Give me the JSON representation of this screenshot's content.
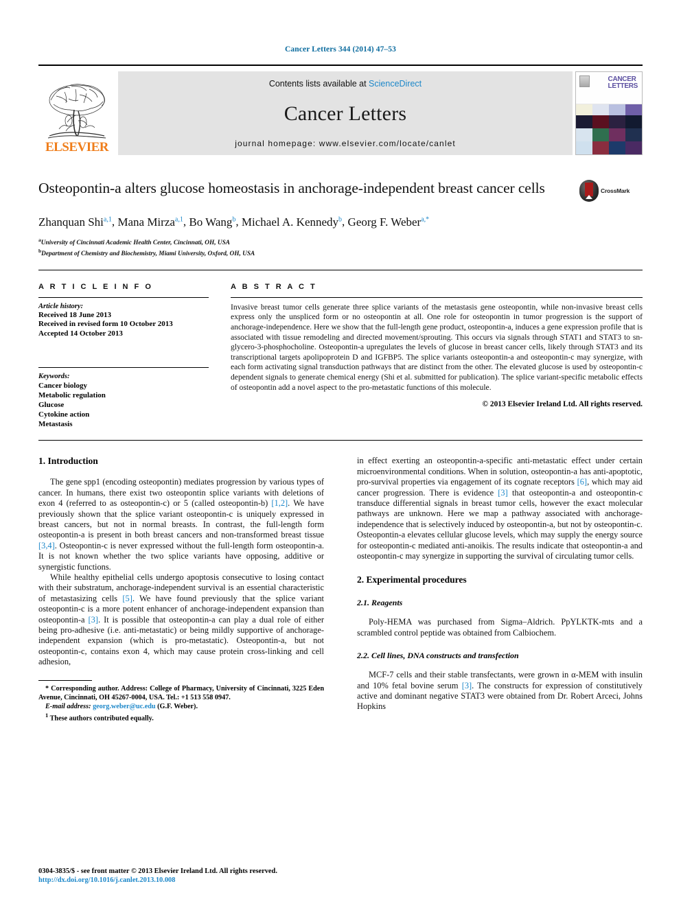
{
  "running_head": "Cancer Letters 344 (2014) 47–53",
  "masthead": {
    "contents_prefix": "Contents lists available at ",
    "sciencedirect": "ScienceDirect",
    "journal_name": "Cancer Letters",
    "homepage": "journal homepage: www.elsevier.com/locate/canlet",
    "publisher": "ELSEVIER",
    "cover_title_line1": "CANCER",
    "cover_title_line2": "LETTERS"
  },
  "article": {
    "title": "Osteopontin-a alters glucose homeostasis in anchorage-independent breast cancer cells",
    "crossmark_label": "CrossMark",
    "affiliation_a": "University of Cincinnati Academic Health Center, Cincinnati, OH, USA",
    "affiliation_b": "Department of Chemistry and Biochemistry, Miami University, Oxford, OH, USA",
    "authors": [
      {
        "name": "Zhanquan Shi",
        "sup": "a,1",
        "sep": ", "
      },
      {
        "name": "Mana Mirza",
        "sup": "a,1",
        "sep": ", "
      },
      {
        "name": "Bo Wang",
        "sup": "b",
        "sep": ", "
      },
      {
        "name": "Michael A. Kennedy",
        "sup": "b",
        "sep": ", "
      },
      {
        "name": "Georg F. Weber",
        "sup": "a,*",
        "sep": ""
      }
    ]
  },
  "info": {
    "heading": "A R T I C L E    I N F O",
    "history_label": "Article history:",
    "history": [
      "Received 18 June 2013",
      "Received in revised form 10 October 2013",
      "Accepted 14 October 2013"
    ],
    "keywords_label": "Keywords:",
    "keywords": [
      "Cancer biology",
      "Metabolic regulation",
      "Glucose",
      "Cytokine action",
      "Metastasis"
    ]
  },
  "abstract": {
    "heading": "A B S T R A C T",
    "text": "Invasive breast tumor cells generate three splice variants of the metastasis gene osteopontin, while non-invasive breast cells express only the unspliced form or no osteopontin at all. One role for osteopontin in tumor progression is the support of anchorage-independence. Here we show that the full-length gene product, osteopontin-a, induces a gene expression profile that is associated with tissue remodeling and directed movement/sprouting. This occurs via signals through STAT1 and STAT3 to sn-glycero-3-phosphocholine. Osteopontin-a upregulates the levels of glucose in breast cancer cells, likely through STAT3 and its transcriptional targets apolipoprotein D and IGFBP5. The splice variants osteopontin-a and osteopontin-c may synergize, with each form activating signal transduction pathways that are distinct from the other. The elevated glucose is used by osteopontin-c dependent signals to generate chemical energy (Shi et al. submitted for publication). The splice variant-specific metabolic effects of osteopontin add a novel aspect to the pro-metastatic functions of this molecule.",
    "copyright": "© 2013 Elsevier Ireland Ltd. All rights reserved."
  },
  "body": {
    "intro_heading": "1. Introduction",
    "intro_p1_a": "The gene spp1 (encoding osteopontin) mediates progression by various types of cancer. In humans, there exist two osteopontin splice variants with deletions of exon 4 (referred to as osteopontin-c) or 5 (called osteopontin-b) ",
    "intro_p1_cite1": "[1,2]",
    "intro_p1_b": ". We have previously shown that the splice variant osteopontin-c is uniquely expressed in breast cancers, but not in normal breasts. In contrast, the full-length form osteopontin-a is present in both breast cancers and non-transformed breast tissue ",
    "intro_p1_cite2": "[3,4]",
    "intro_p1_c": ". Osteopontin-c is never expressed without the full-length form osteopontin-a. It is not known whether the two splice variants have opposing, additive or synergistic functions.",
    "intro_p2_a": "While healthy epithelial cells undergo apoptosis consecutive to losing contact with their substratum, anchorage-independent survival is an essential characteristic of metastasizing cells ",
    "intro_p2_cite1": "[5]",
    "intro_p2_b": ". We have found previously that the splice variant osteopontin-c is a more potent enhancer of anchorage-independent expansion than osteopontin-a ",
    "intro_p2_cite2": "[3]",
    "intro_p2_c": ". It is possible that osteopontin-a can play a dual role of either being pro-adhesive (i.e. anti-metastatic) or being mildly supportive of anchorage-independent expansion (which is pro-metastatic). Osteopontin-a, but not osteopontin-c, contains exon 4, which may cause protein cross-linking and cell adhesion,",
    "right_p1_a": "in effect exerting an osteopontin-a-specific anti-metastatic effect under certain microenvironmental conditions. When in solution, osteopontin-a has anti-apoptotic, pro-survival properties via engagement of its cognate receptors ",
    "right_p1_cite1": "[6]",
    "right_p1_b": ", which may aid cancer progression. There is evidence ",
    "right_p1_cite2": "[3]",
    "right_p1_c": " that osteopontin-a and osteopontin-c transduce differential signals in breast tumor cells, however the exact molecular pathways are unknown. Here we map a pathway associated with anchorage-independence that is selectively induced by osteopontin-a, but not by osteopontin-c. Osteopontin-a elevates cellular glucose levels, which may supply the energy source for osteopontin-c mediated anti-anoikis. The results indicate that osteopontin-a and osteopontin-c may synergize in supporting the survival of circulating tumor cells.",
    "exp_heading": "2. Experimental procedures",
    "sub21_heading": "2.1. Reagents",
    "sub21_text": "Poly-HEMA was purchased from Sigma–Aldrich. PpYLKTK-mts and a scrambled control peptide was obtained from Calbiochem.",
    "sub22_heading": "2.2. Cell lines, DNA constructs and transfection",
    "sub22_a": "MCF-7 cells and their stable transfectants, were grown in α-MEM with insulin and 10% fetal bovine serum ",
    "sub22_cite": "[3]",
    "sub22_b": ". The constructs for expression of constitutively active and dominant negative STAT3 were obtained from Dr. Robert Arceci, Johns Hopkins"
  },
  "footnotes": {
    "corresponding_marker": "*",
    "corresponding": " Corresponding author. Address: College of Pharmacy, University of Cincinnati, 3225 Eden Avenue, Cincinnati, OH 45267-0004, USA. Tel.: +1 513 558 0947.",
    "email_label": "E-mail address:",
    "email": "georg.weber@uc.edu",
    "email_suffix": " (G.F. Weber).",
    "equal_marker": "1",
    "equal_text": " These authors contributed equally."
  },
  "page_footer": {
    "issn": "0304-3835/$ - see front matter © 2013 Elsevier Ireland Ltd. All rights reserved.",
    "doi": "http://dx.doi.org/10.1016/j.canlet.2013.10.008"
  },
  "colors": {
    "link": "#1c87c9",
    "elsevier_orange": "#ef7d1a",
    "masthead_gray": "#e3e3e3"
  }
}
